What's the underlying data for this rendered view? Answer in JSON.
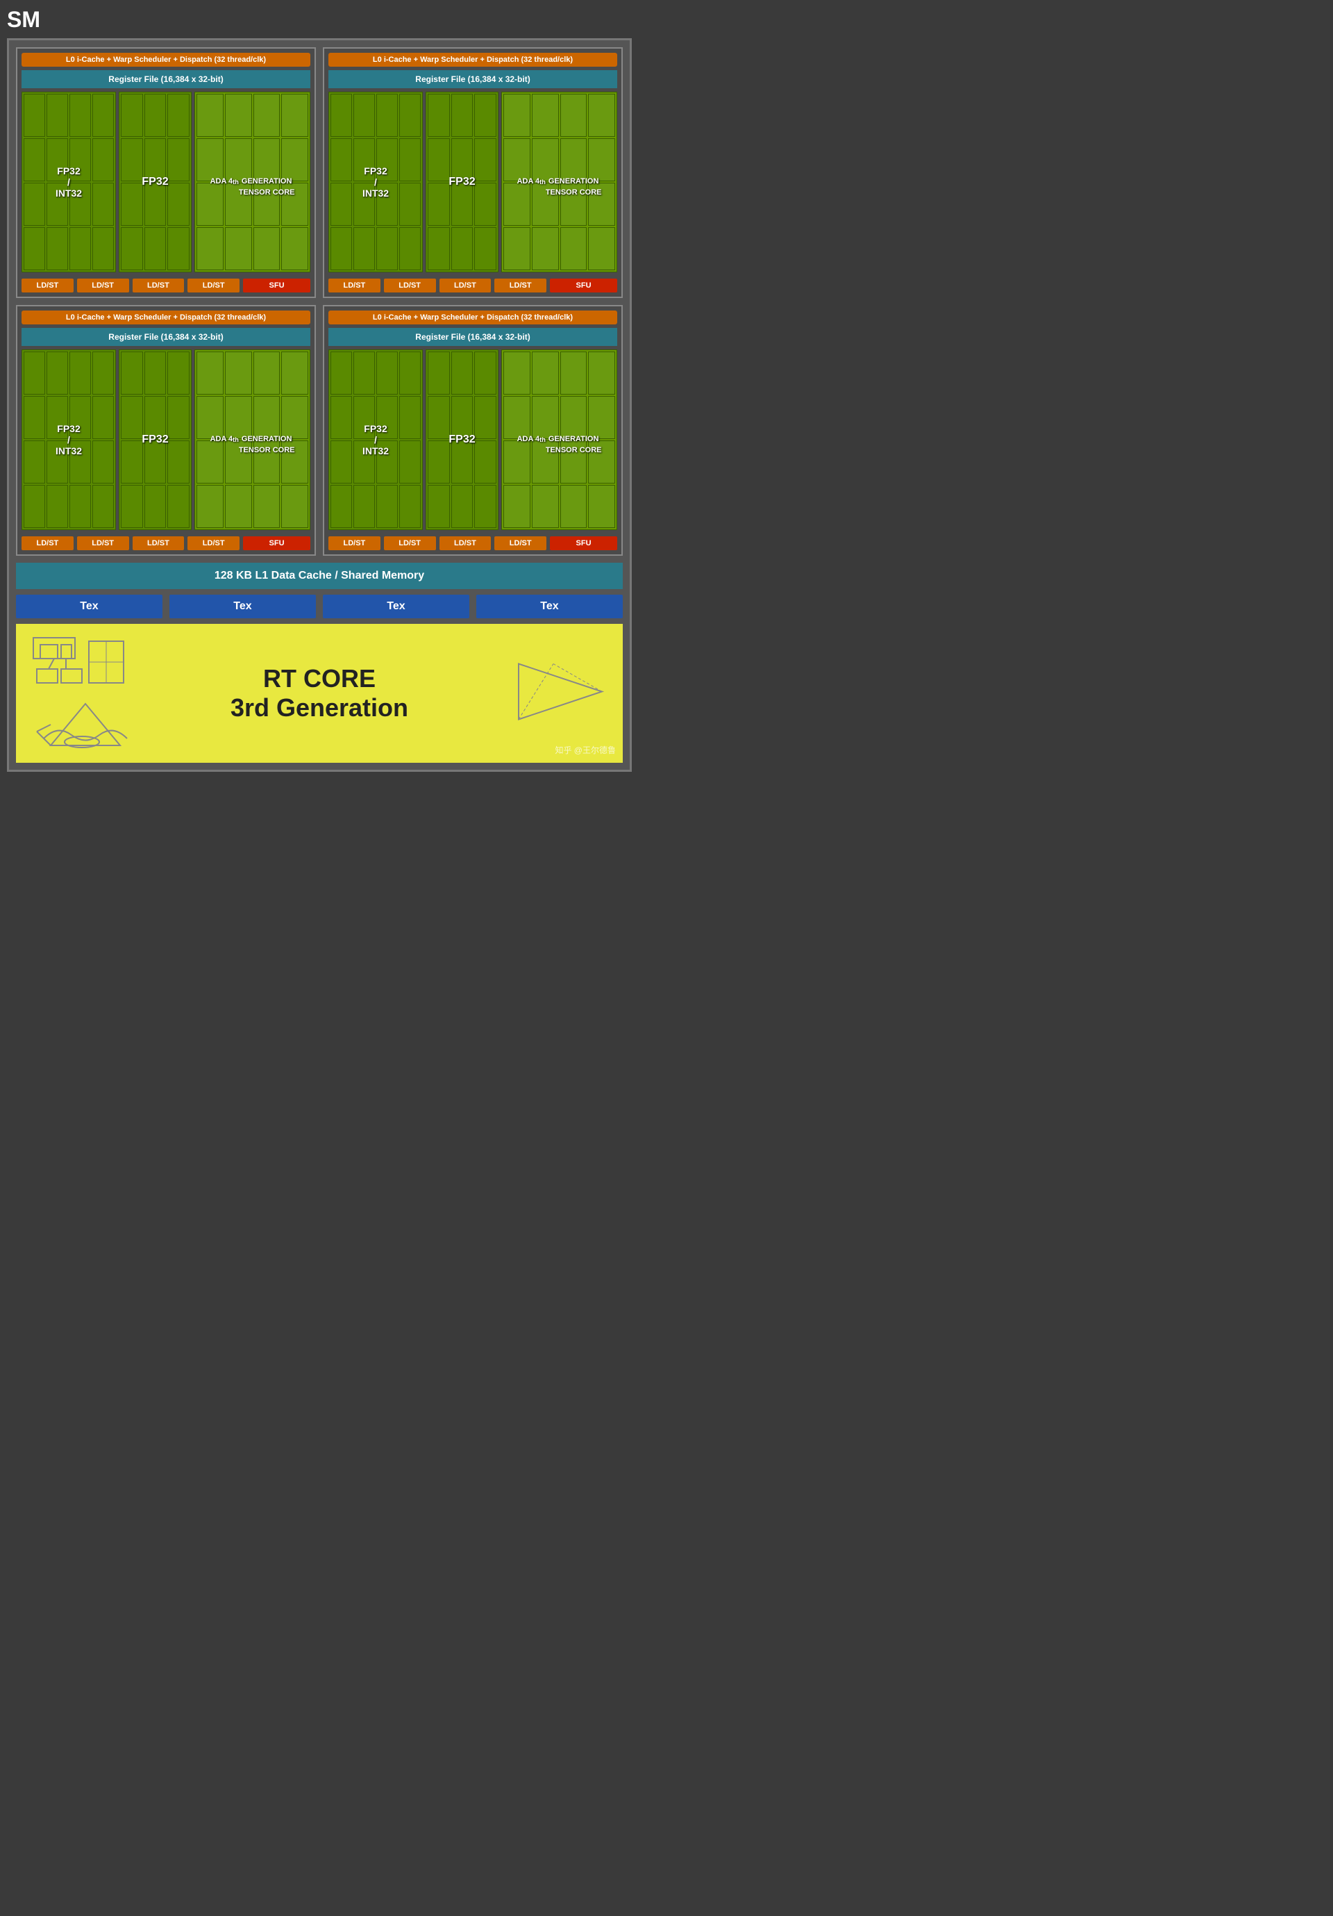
{
  "title": "SM",
  "quad_units": [
    {
      "id": "sub-sm-1",
      "warp_label": "L0 i-Cache + Warp Scheduler + Dispatch (32 thread/clk)",
      "register_label": "Register File (16,384 x 32-bit)",
      "fp32_int32_label": "FP32\n/\nINT32",
      "fp32_label": "FP32",
      "tensor_label": "ADA 4th GENERATION TENSOR CORE",
      "ldst_labels": [
        "LD/ST",
        "LD/ST",
        "LD/ST",
        "LD/ST"
      ],
      "sfu_label": "SFU"
    },
    {
      "id": "sub-sm-2",
      "warp_label": "L0 i-Cache + Warp Scheduler + Dispatch (32 thread/clk)",
      "register_label": "Register File (16,384 x 32-bit)",
      "fp32_int32_label": "FP32\n/\nINT32",
      "fp32_label": "FP32",
      "tensor_label": "ADA 4th GENERATION TENSOR CORE",
      "ldst_labels": [
        "LD/ST",
        "LD/ST",
        "LD/ST",
        "LD/ST"
      ],
      "sfu_label": "SFU"
    },
    {
      "id": "sub-sm-3",
      "warp_label": "L0 i-Cache + Warp Scheduler + Dispatch (32 thread/clk)",
      "register_label": "Register File (16,384 x 32-bit)",
      "fp32_int32_label": "FP32\n/\nINT32",
      "fp32_label": "FP32",
      "tensor_label": "ADA 4th GENERATION TENSOR CORE",
      "ldst_labels": [
        "LD/ST",
        "LD/ST",
        "LD/ST",
        "LD/ST"
      ],
      "sfu_label": "SFU"
    },
    {
      "id": "sub-sm-4",
      "warp_label": "L0 i-Cache + Warp Scheduler + Dispatch (32 thread/clk)",
      "register_label": "Register File (16,384 x 32-bit)",
      "fp32_int32_label": "FP32\n/\nINT32",
      "fp32_label": "FP32",
      "tensor_label": "ADA 4th GENERATION TENSOR CORE",
      "ldst_labels": [
        "LD/ST",
        "LD/ST",
        "LD/ST",
        "LD/ST"
      ],
      "sfu_label": "SFU"
    }
  ],
  "l1_cache_label": "128 KB L1 Data Cache / Shared Memory",
  "tex_labels": [
    "Tex",
    "Tex",
    "Tex",
    "Tex"
  ],
  "rt_core_label": "RT CORE\n3rd Generation",
  "watermark": "知乎 @王尔德鲁"
}
